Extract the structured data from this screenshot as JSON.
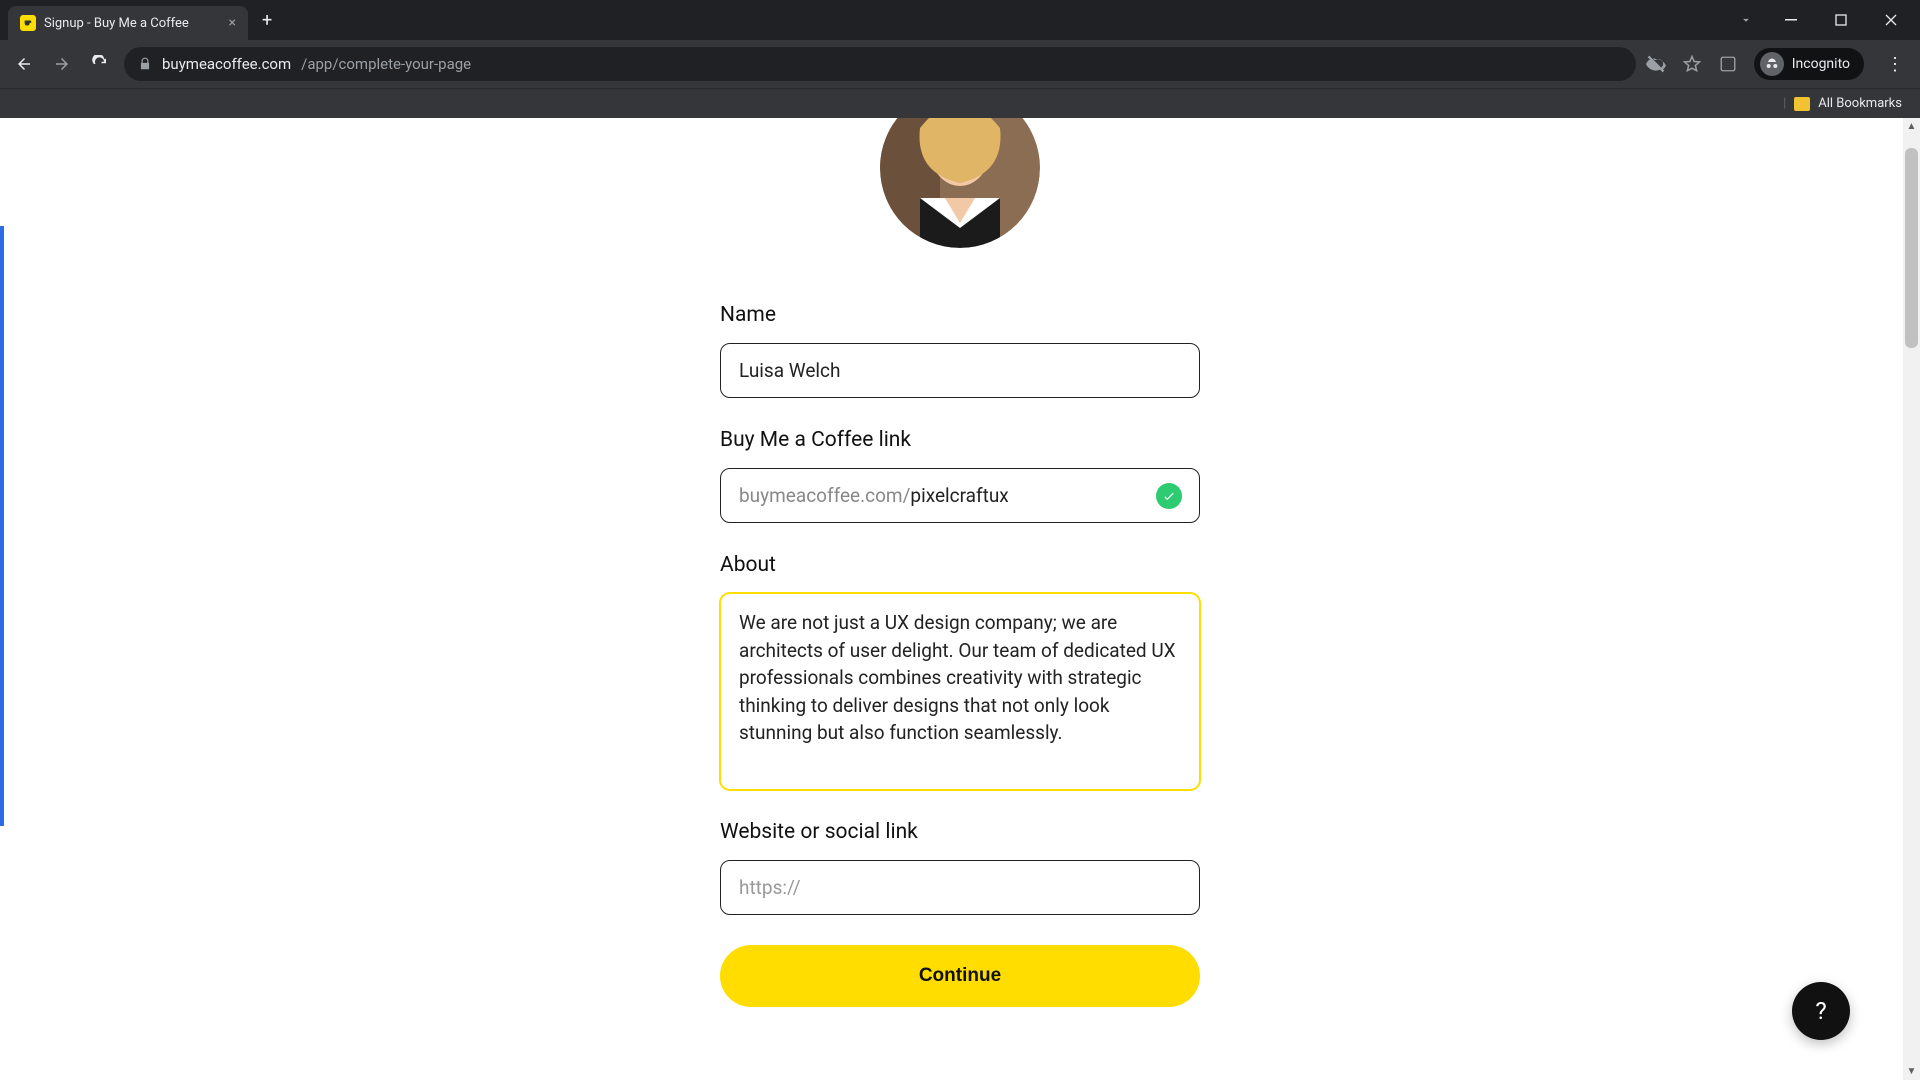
{
  "browser": {
    "tab_title": "Signup - Buy Me a Coffee",
    "url_domain": "buymeacoffee.com",
    "url_path": "/app/complete-your-page",
    "incognito_label": "Incognito",
    "bookmarks_label": "All Bookmarks"
  },
  "form": {
    "name_label": "Name",
    "name_value": "Luisa Welch",
    "link_label": "Buy Me a Coffee link",
    "link_prefix": "buymeacoffee.com/",
    "link_value": "pixelcraftux",
    "about_label": "About",
    "about_value": "We are not just a UX design company; we are architects of user delight. Our team of dedicated UX professionals combines creativity with strategic thinking to deliver designs that not only look stunning but also function seamlessly.",
    "website_label": "Website or social link",
    "website_placeholder": "https://",
    "website_value": "",
    "continue_label": "Continue"
  },
  "help_fab": "?"
}
